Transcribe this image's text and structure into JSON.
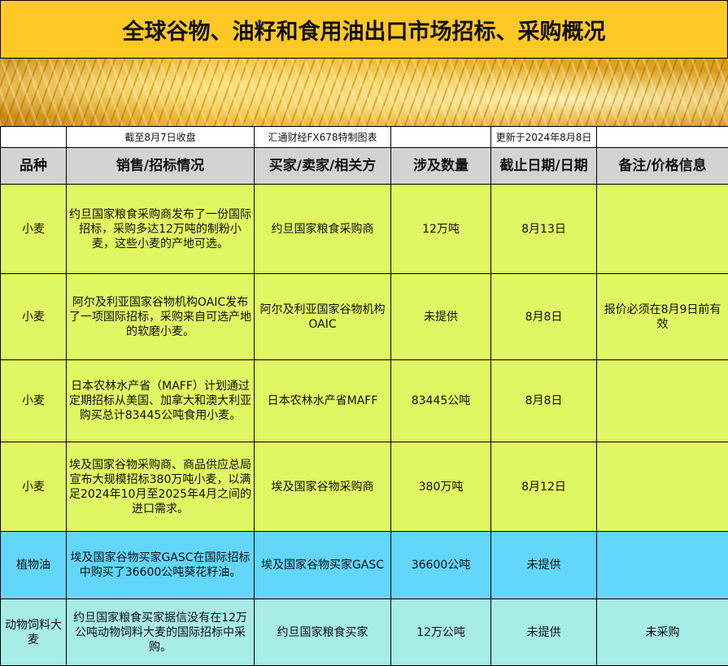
{
  "title": "全球谷物、油籽和食用油出口市场招标、采购概况",
  "info": [
    "",
    "截至8月7日收盘",
    "汇通财经FX678特制图表",
    "",
    "更新于2024年8月8日",
    ""
  ],
  "headers": [
    "品种",
    "销售/招标情况",
    "买家/卖家/相关方",
    "涉及数量",
    "截止日期/日期",
    "备注/价格信息"
  ],
  "rows": [
    {
      "type": "y",
      "h": 110,
      "cells": [
        "小麦",
        "约旦国家粮食采购商发布了一份国际招标，采购多达12万吨的制粉小麦，这些小麦的产地可选。",
        "约旦国家粮食采购商",
        "12万吨",
        "8月13日",
        ""
      ]
    },
    {
      "type": "y",
      "h": 106,
      "cells": [
        "小麦",
        "阿尔及利亚国家谷物机构OAIC发布了一项国际招标，采购来自可选产地的软磨小麦。",
        "阿尔及利亚国家谷物机构OAIC",
        "未提供",
        "8月8日",
        "报价必须在8月9日前有效"
      ]
    },
    {
      "type": "y",
      "h": 101,
      "cells": [
        "小麦",
        "日本农林水产省（MAFF）计划通过定期招标从美国、加拿大和澳大利亚购买总计83445公吨食用小麦。",
        "日本农林水产省MAFF",
        "83445公吨",
        "8月8日",
        ""
      ]
    },
    {
      "type": "y",
      "h": 110,
      "cells": [
        "小麦",
        "埃及国家谷物采购商、商品供应总局宣布大规模招标380万吨小麦，以满足2024年10月至2025年4月之间的进口需求。",
        "埃及国家谷物采购商",
        "380万吨",
        "8月12日",
        ""
      ]
    },
    {
      "type": "b",
      "h": 83,
      "cells": [
        "植物油",
        "埃及国家谷物买家GASC在国际招标中购买了36600公吨葵花籽油。",
        "埃及国家谷物买家GASC",
        "36600公吨",
        "未提供",
        ""
      ]
    },
    {
      "type": "t",
      "h": 82,
      "cells": [
        "动物饲料大麦",
        "约旦国家粮食买家据信没有在12万公吨动物饲料大麦的国际招标中采购。",
        "约旦国家粮食买家",
        "12万公吨",
        "未提供",
        "未采购"
      ]
    }
  ]
}
